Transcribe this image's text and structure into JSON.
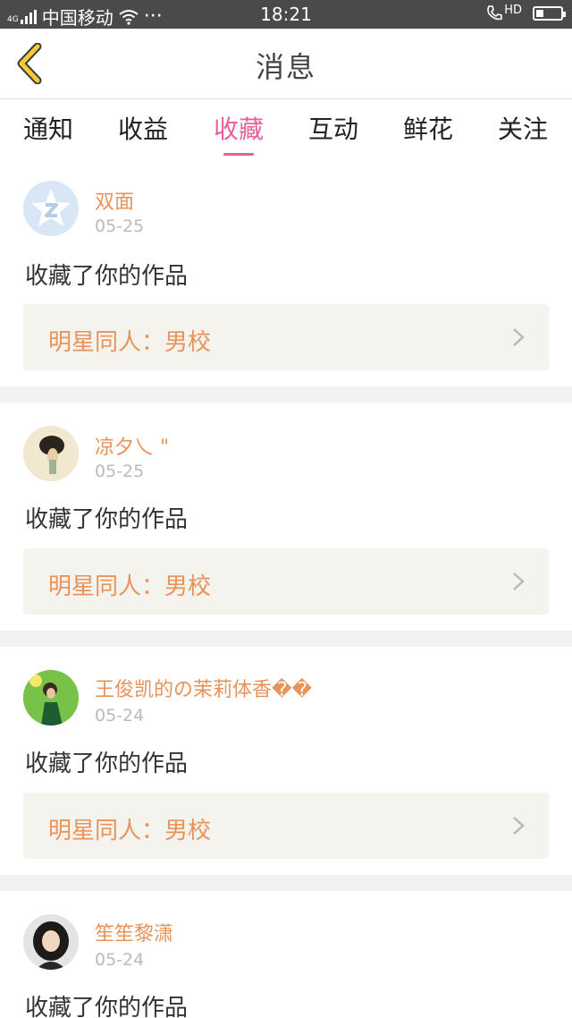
{
  "status_bar": {
    "signal_label": "4G",
    "carrier": "中国移动",
    "dots": "···",
    "time": "18:21",
    "hd_label": "HD",
    "icons": [
      "signal-icon",
      "wifi-icon",
      "phone-hd-icon",
      "battery-icon"
    ]
  },
  "nav": {
    "title": "消息",
    "back_icon": "chevron-left-icon",
    "accent": "#f4cb37"
  },
  "tabs": [
    {
      "label": "通知"
    },
    {
      "label": "收益"
    },
    {
      "label": "收藏",
      "active": true
    },
    {
      "label": "互动"
    },
    {
      "label": "鲜花"
    },
    {
      "label": "关注"
    }
  ],
  "colors": {
    "active_tab": "#e7609a",
    "name": "#e8935a",
    "work_bg": "#f4f3ee",
    "separator": "#f2f2f2"
  },
  "messages": [
    {
      "name": "双面",
      "date": "05-25",
      "action": "收藏了你的作品",
      "work": "明星同人：男校",
      "avatar": "qq-logo-avatar"
    },
    {
      "name": "凉夕乀 \"",
      "date": "05-25",
      "action": "收藏了你的作品",
      "work": "明星同人：男校",
      "avatar": "photo-avatar"
    },
    {
      "name": "王俊凯的の茉莉体香��",
      "date": "05-24",
      "action": "收藏了你的作品",
      "work": "明星同人：男校",
      "avatar": "photo-avatar"
    },
    {
      "name": "笙笙黎潇",
      "date": "05-24",
      "action": "收藏了你的作品",
      "avatar": "photo-avatar"
    }
  ]
}
